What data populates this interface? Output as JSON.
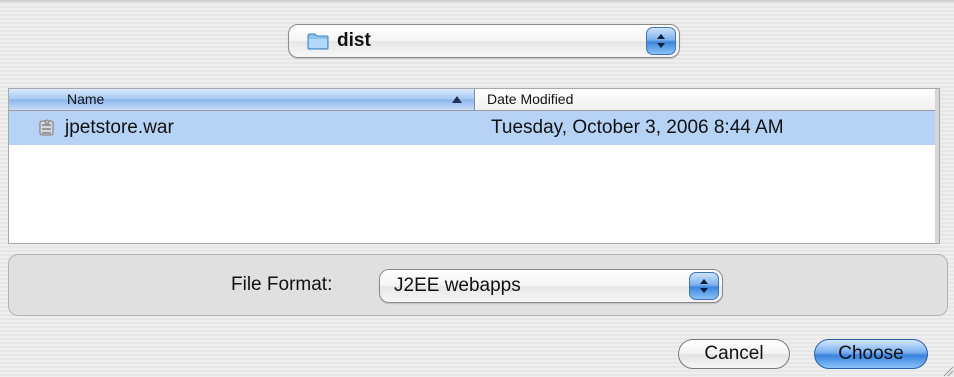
{
  "location": {
    "folder_name": "dist",
    "icon": "folder-icon"
  },
  "browser": {
    "columns": {
      "name": "Name",
      "date_modified": "Date Modified"
    },
    "sort": "ascending",
    "files": [
      {
        "name": "jpetstore.war",
        "date_modified": "Tuesday, October 3, 2006 8:44 AM",
        "icon": "war-file-icon",
        "selected": true
      }
    ]
  },
  "format": {
    "label": "File Format:",
    "selected": "J2EE webapps"
  },
  "buttons": {
    "cancel": "Cancel",
    "choose": "Choose"
  },
  "colors": {
    "selection": "#b6d3f6",
    "aqua_blue": "#3983e0",
    "window_bg": "#ececec"
  }
}
